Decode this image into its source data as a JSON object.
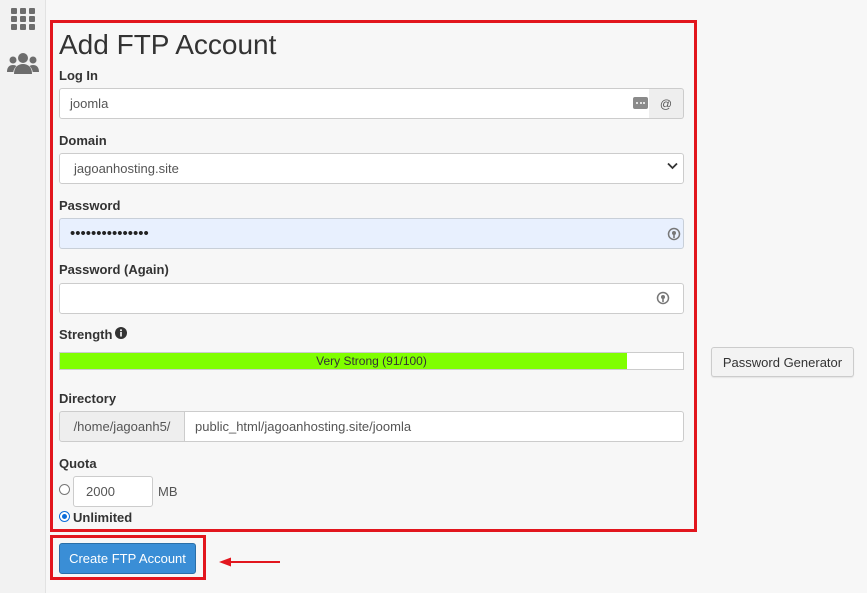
{
  "page": {
    "title": "Add FTP Account"
  },
  "login": {
    "label": "Log In",
    "value": "joomla",
    "addon": "@"
  },
  "domain": {
    "label": "Domain",
    "selected": "jagoanhosting.site"
  },
  "password": {
    "label": "Password",
    "masked_value": "•••••••••••••••"
  },
  "password_again": {
    "label": "Password (Again)",
    "value": ""
  },
  "strength": {
    "label": "Strength",
    "text": "Very Strong (91/100)",
    "score": 91,
    "bar_color": "#80ff00"
  },
  "generator": {
    "label": "Password Generator"
  },
  "directory": {
    "label": "Directory",
    "prefix": "/home/jagoanh5/",
    "value": "public_html/jagoanhosting.site/joomla"
  },
  "quota": {
    "label": "Quota",
    "value": "2000",
    "unit": "MB",
    "unlimited_label": "Unlimited",
    "selected": "unlimited"
  },
  "submit": {
    "label": "Create FTP Account",
    "color": "#3a8ed6"
  },
  "annotation_color": "#e2161e",
  "sidebar": {
    "icons": [
      "grid-icon",
      "users-icon"
    ]
  }
}
